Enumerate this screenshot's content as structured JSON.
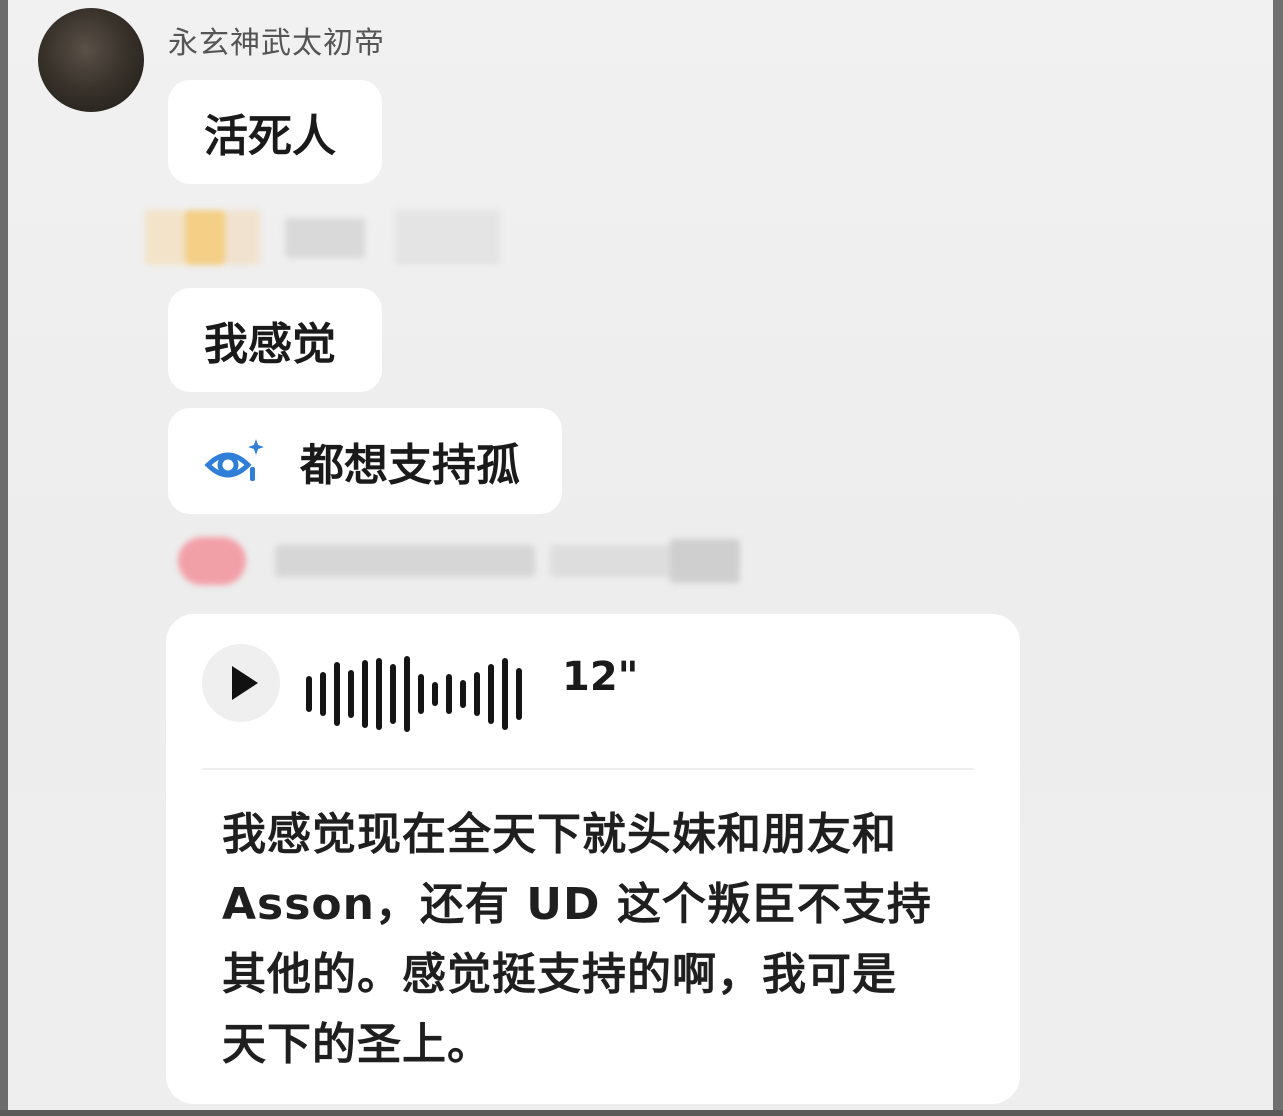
{
  "sender": {
    "name": "永玄神武太初帝"
  },
  "messages": [
    {
      "text": "活死人"
    },
    {
      "text": "我感觉"
    },
    {
      "text": "都想支持孤",
      "icon": "eye-sparkle-icon"
    }
  ],
  "voice_message": {
    "duration": "12\"",
    "transcript": "我感觉现在全天下就头妹和朋友和Asson，还有 UD 这个叛臣不支持其他的。感觉挺支持的啊，我可是天下的圣上。",
    "transcript_lines": [
      "我感觉现在全天下就头妹和朋友和",
      "Asson，还有 UD 这个叛臣不支持",
      "其他的。感觉挺支持的啊，我可是",
      "天下的圣上。"
    ],
    "waveform_levels": [
      0.45,
      0.55,
      0.8,
      0.6,
      0.85,
      0.9,
      0.75,
      0.95,
      0.5,
      0.3,
      0.5,
      0.35,
      0.55,
      0.75,
      0.9,
      0.65
    ]
  },
  "colors": {
    "background": "#efefef",
    "bubble": "#ffffff",
    "text": "#1a1a1a",
    "accent_blue": "#2f7fd8"
  }
}
